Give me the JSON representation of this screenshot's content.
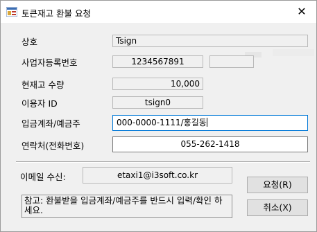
{
  "window": {
    "title": "토큰재고 환불 요청",
    "close_glyph": "✕"
  },
  "form": {
    "company_label": "상호",
    "company_value": "Tsign",
    "bizno_label": "사업자등록번호",
    "bizno_value": "1234567891",
    "bizno_extra_value": "",
    "stock_label": "현재고 수량",
    "stock_value": "10,000",
    "user_label": "이용자 ID",
    "user_value": "tsign0",
    "account_label": "입금계좌/예금주",
    "account_value": "000-0000-1111/홍길동",
    "phone_label": "연락처(전화번호)",
    "phone_value": "055-262-1418",
    "email_label": "이메일 수신:",
    "email_value": "etaxi1@i3soft.co.kr"
  },
  "buttons": {
    "request": "요청(R)",
    "cancel": "취소(X)"
  },
  "note": "참고: 환불받을 입금계좌/예금주를 반드시 입력/확인 하세요.",
  "colors": {
    "focus_border": "#0078d7",
    "background": "#f0f0f0"
  }
}
